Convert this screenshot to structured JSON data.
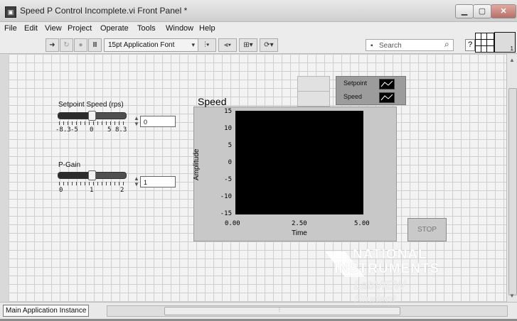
{
  "window": {
    "title": "Speed P Control Incomplete.vi Front Panel *"
  },
  "menu": [
    "File",
    "Edit",
    "View",
    "Project",
    "Operate",
    "Tools",
    "Window",
    "Help"
  ],
  "toolbar": {
    "font": "15pt Application Font",
    "search_placeholder": "Search",
    "run_icon": "arrow-run-icon",
    "pause_label": "II"
  },
  "controls": {
    "setpoint": {
      "label": "Setpoint Speed (rps)",
      "ticks": [
        "-8.3",
        "-5",
        "0",
        "5",
        "8.3"
      ],
      "value": "0",
      "level": 0.5
    },
    "pgain": {
      "label": "P-Gain",
      "ticks": [
        "0",
        "1",
        "2"
      ],
      "value": "1",
      "level": 0.5
    }
  },
  "chart": {
    "title": "Speed",
    "yticks": [
      "15",
      "10",
      "5",
      "0",
      "-5",
      "-10",
      "-15"
    ],
    "xticks": [
      "0.00",
      "2.50",
      "5.00"
    ],
    "ylabel": "Amplitude",
    "xlabel": "Time",
    "legend": [
      "Setpoint",
      "Speed"
    ]
  },
  "chart_data": {
    "type": "line",
    "title": "Speed",
    "xlabel": "Time",
    "ylabel": "Amplitude",
    "xlim": [
      0,
      5
    ],
    "ylim": [
      -15,
      15
    ],
    "series": [
      {
        "name": "Setpoint",
        "values": []
      },
      {
        "name": "Speed",
        "values": []
      }
    ]
  },
  "stop_button": "STOP",
  "status": {
    "context": "Main Application Instance"
  },
  "watermark": {
    "line1": "NATIONAL",
    "line2": "INSTRUMENTS",
    "line3": "LabVIEW Student Edition"
  }
}
